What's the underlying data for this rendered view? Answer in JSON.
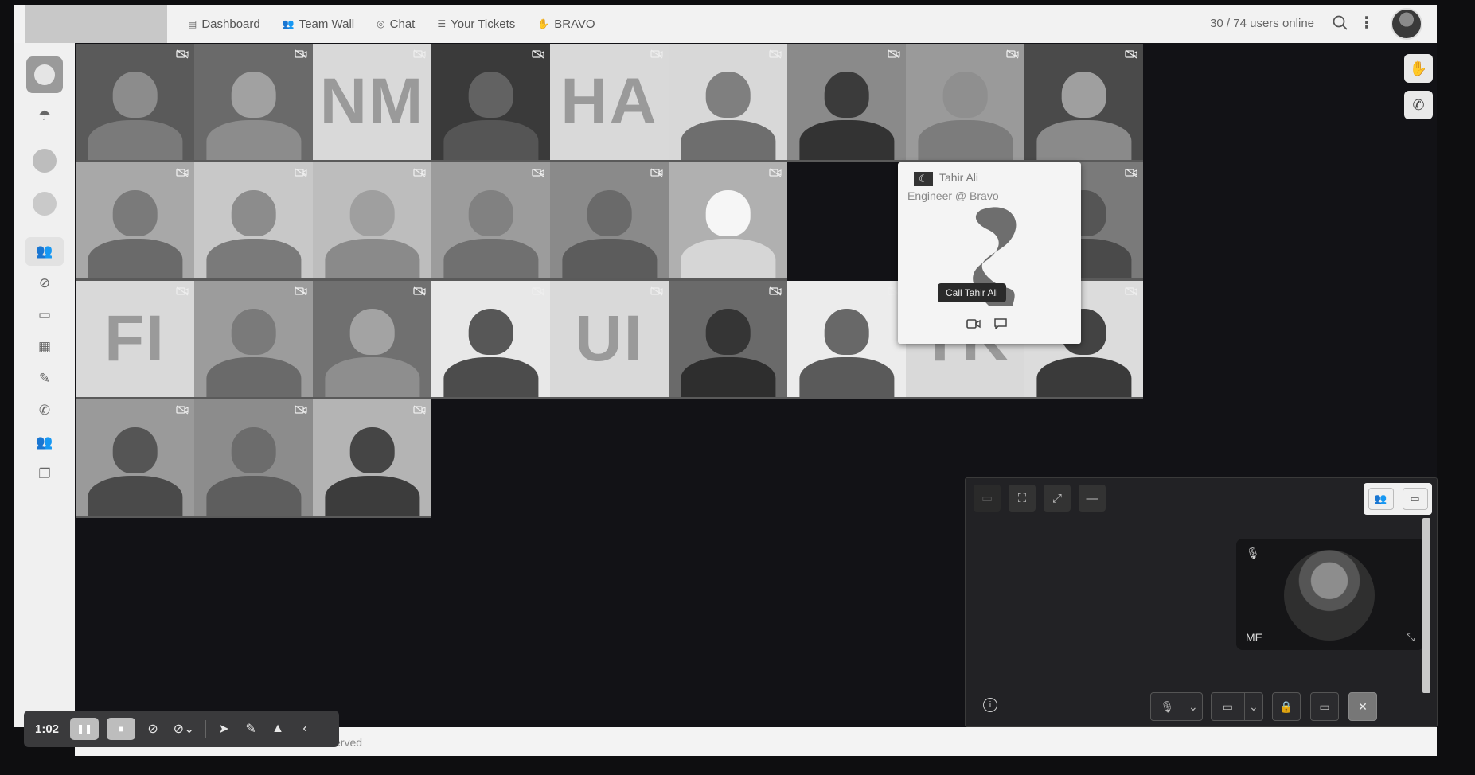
{
  "nav": {
    "dashboard": "Dashboard",
    "team_wall": "Team Wall",
    "chat": "Chat",
    "tickets": "Your Tickets",
    "bravo": "BRAVO"
  },
  "users_online": "30 / 74 users online",
  "tiles": [
    {
      "type": "photo",
      "tone": "#7a7a7a",
      "bg": "#5a5a5a"
    },
    {
      "type": "photo",
      "tone": "#8c8c8c",
      "bg": "#6a6a6a"
    },
    {
      "type": "initials",
      "text": "NM"
    },
    {
      "type": "photo",
      "tone": "#555555",
      "bg": "#3a3a3a"
    },
    {
      "type": "initials",
      "text": "HA"
    },
    {
      "type": "photo",
      "tone": "#6e6e6e",
      "bg": "#d8d8d8"
    },
    {
      "type": "photo",
      "tone": "#333333",
      "bg": "#8a8a8a"
    },
    {
      "type": "photo",
      "tone": "#7c7c7c",
      "bg": "#9a9a9a"
    },
    {
      "type": "photo",
      "tone": "#8a8a8a",
      "bg": "#4a4a4a"
    },
    {
      "type": "photo",
      "tone": "#6a6a6a",
      "bg": "#a8a8a8"
    },
    {
      "type": "photo",
      "tone": "#7a7a7a",
      "bg": "#c8c8c8"
    },
    {
      "type": "photo",
      "tone": "#8a8a8a",
      "bg": "#bdbdbd"
    },
    {
      "type": "photo",
      "tone": "#707070",
      "bg": "#9c9c9c"
    },
    {
      "type": "photo",
      "tone": "#5c5c5c",
      "bg": "#8a8a8a"
    },
    {
      "type": "photo",
      "tone": "#d6d6d6",
      "bg": "#b0b0b0"
    },
    {
      "type": "popup"
    },
    {
      "type": "photo",
      "tone": "#6c6c6c",
      "bg": "#c4c4c4"
    },
    {
      "type": "photo",
      "tone": "#4a4a4a",
      "bg": "#7a7a7a"
    },
    {
      "type": "initials",
      "text": "FI"
    },
    {
      "type": "photo",
      "tone": "#6a6a6a",
      "bg": "#9c9c9c"
    },
    {
      "type": "photo",
      "tone": "#8e8e8e",
      "bg": "#707070"
    },
    {
      "type": "photo",
      "tone": "#4c4c4c",
      "bg": "#e8e8e8"
    },
    {
      "type": "initials",
      "text": "UI"
    },
    {
      "type": "photo",
      "tone": "#2e2e2e",
      "bg": "#6a6a6a"
    },
    {
      "type": "photo",
      "tone": "#5a5a5a",
      "bg": "#ececec"
    },
    {
      "type": "initials",
      "text": "TK"
    },
    {
      "type": "photo",
      "tone": "#3a3a3a",
      "bg": "#dcdcdc"
    },
    {
      "type": "photo",
      "tone": "#4a4a4a",
      "bg": "#9a9a9a"
    },
    {
      "type": "photo",
      "tone": "#5e5e5e",
      "bg": "#8c8c8c"
    },
    {
      "type": "photo",
      "tone": "#3c3c3c",
      "bg": "#b4b4b4"
    }
  ],
  "popup": {
    "name": "Tahir Ali",
    "role": "Engineer @ Bravo",
    "tooltip": "Call Tahir Ali"
  },
  "self_view": {
    "label": "ME"
  },
  "recording": {
    "time": "1:02"
  },
  "footer_text": "erved"
}
